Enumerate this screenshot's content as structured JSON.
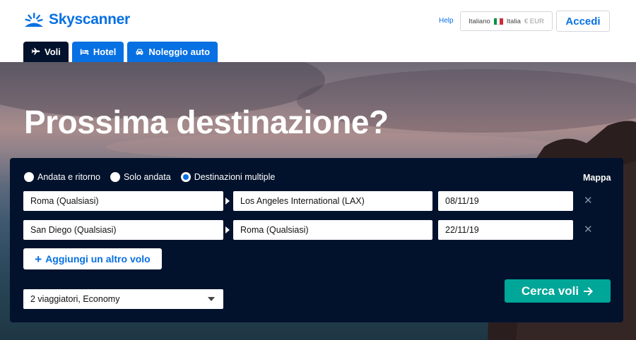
{
  "brand": {
    "name": "Skyscanner",
    "color": "#0770e3"
  },
  "header": {
    "help_label": "Help",
    "locale": {
      "language": "Italiano",
      "country": "Italia",
      "currency": "€ EUR"
    },
    "login_label": "Accedi"
  },
  "tabs": [
    {
      "label": "Voli",
      "icon": "plane-icon",
      "active": true
    },
    {
      "label": "Hotel",
      "icon": "bed-icon",
      "active": false
    },
    {
      "label": "Noleggio auto",
      "icon": "car-icon",
      "active": false
    }
  ],
  "hero": {
    "title": "Prossima destinazione?"
  },
  "search": {
    "trip_types": [
      {
        "label": "Andata e ritorno",
        "selected": false
      },
      {
        "label": "Solo andata",
        "selected": false
      },
      {
        "label": "Destinazioni multiple",
        "selected": true
      }
    ],
    "map_label": "Mappa",
    "legs": [
      {
        "from": "Roma (Qualsiasi)",
        "to": "Los Angeles International (LAX)",
        "date": "08/11/19"
      },
      {
        "from": "San Diego (Qualsiasi)",
        "to": "Roma (Qualsiasi)",
        "date": "22/11/19"
      }
    ],
    "add_flight_label": "Aggiungi un altro volo",
    "travellers": "2 viaggiatori, Economy",
    "submit_label": "Cerca voli"
  }
}
